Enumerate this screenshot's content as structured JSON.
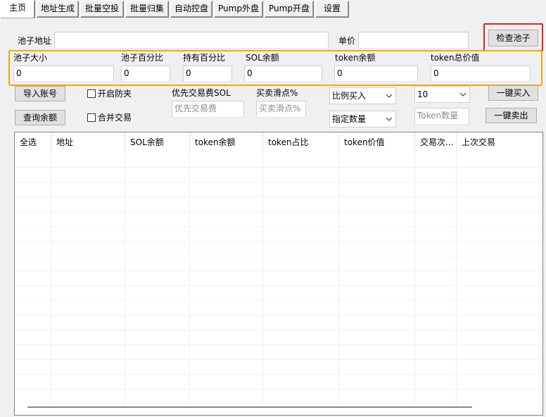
{
  "tabs": [
    "主页",
    "地址生成",
    "批量空投",
    "批量归集",
    "自动控盘",
    "Pump外盘",
    "Pump开盘",
    "设置"
  ],
  "pool": {
    "address_label": "池子地址",
    "address_value": "",
    "price_label": "单价",
    "price_value": "",
    "check_button": "检查池子"
  },
  "stats": {
    "size_label": "池子大小",
    "size_value": "0",
    "pct_label": "池子百分比",
    "pct_value": "0",
    "hold_label": "持有百分比",
    "hold_value": "0",
    "sol_label": "SOL余额",
    "sol_value": "0",
    "token_label": "token余额",
    "token_value": "0",
    "value_label": "token总价值",
    "value_value": "0"
  },
  "highlight_colors": {
    "stats_box": "#f5a800",
    "check_box": "#e8231f"
  },
  "controls": {
    "import_button": "导入账号",
    "query_button": "查询余额",
    "anti_sandwich_label": "开启防夹",
    "merge_trade_label": "合并交易",
    "priority_fee_label": "优先交易费SOL",
    "priority_fee_placeholder": "优先交易费",
    "slippage_label": "买卖滑点%",
    "slippage_placeholder": "买卖滑点%",
    "buy_mode_select": "比例买入",
    "amount_mode_select": "指定数量",
    "ratio_select": "10",
    "token_amount_placeholder": "Token数量",
    "buy_all_button": "一键买入",
    "sell_all_button": "一键卖出"
  },
  "table": {
    "columns": [
      "全选",
      "地址",
      "SOL余额",
      "token余额",
      "token占比",
      "token价值",
      "交易次...",
      "上次交易"
    ],
    "rows": []
  }
}
